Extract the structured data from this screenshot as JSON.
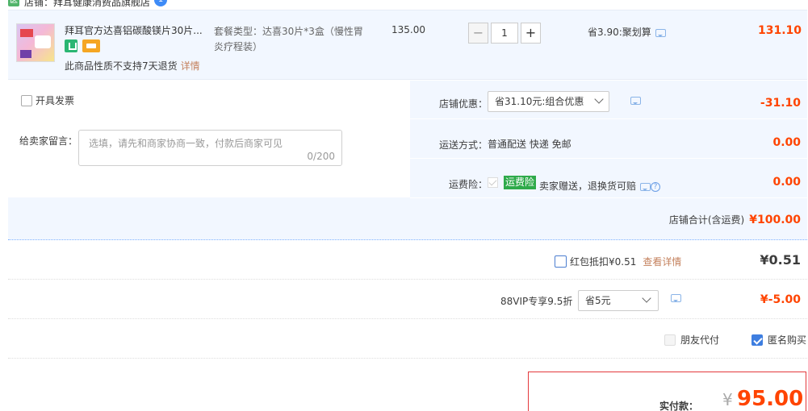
{
  "shop": {
    "icon_char": "医",
    "label": "店铺：拜耳健康消费品旗舰店",
    "ww_badge": "1"
  },
  "item": {
    "title": "拜耳官方达喜铝碳酸镁片30片...",
    "return_note": "此商品性质不支持7天退货",
    "return_more": "详情",
    "sku": "套餐类型：达喜30片*3盒（慢性胃炎疗程装）",
    "unit_price": "135.00",
    "qty_minus": "−",
    "qty_value": "1",
    "qty_plus": "+",
    "promo": "省3.90:聚划算",
    "total": "131.10"
  },
  "invoice": {
    "label": "开具发票"
  },
  "message": {
    "label": "给卖家留言：",
    "placeholder": "选填，请先和商家协商一致，付款后商家可见",
    "counter": "0/200"
  },
  "shop_discount": {
    "label": "店铺优惠：",
    "selected": "省31.10元:组合优惠",
    "value": "-31.10"
  },
  "shipping": {
    "label": "运送方式：",
    "method": "普通配送 快递 免邮",
    "value": "0.00"
  },
  "insurance": {
    "label": "运费险：",
    "tag": "运费险",
    "text": "卖家赠送，退换货可赔",
    "help": "?",
    "value": "0.00"
  },
  "shop_total": {
    "label": "店铺合计(含运费)",
    "value": "¥100.00"
  },
  "red_packet": {
    "label": "红包抵扣¥0.51",
    "more": "查看详情",
    "value": "¥0.51"
  },
  "vip": {
    "label": "88VIP专享9.5折",
    "selected": "省5元",
    "value": "¥-5.00"
  },
  "friend_pay": {
    "label": "朋友代付"
  },
  "anonymous": {
    "label": "匿名购买"
  },
  "payment": {
    "label": "实付款：",
    "currency": "¥",
    "amount": "95.00"
  },
  "colors": {
    "accent_red": "#ff4400",
    "panel_blue": "#f2f7ff",
    "link_brown": "#c4815d",
    "insurance_green": "#2eaa4a"
  }
}
